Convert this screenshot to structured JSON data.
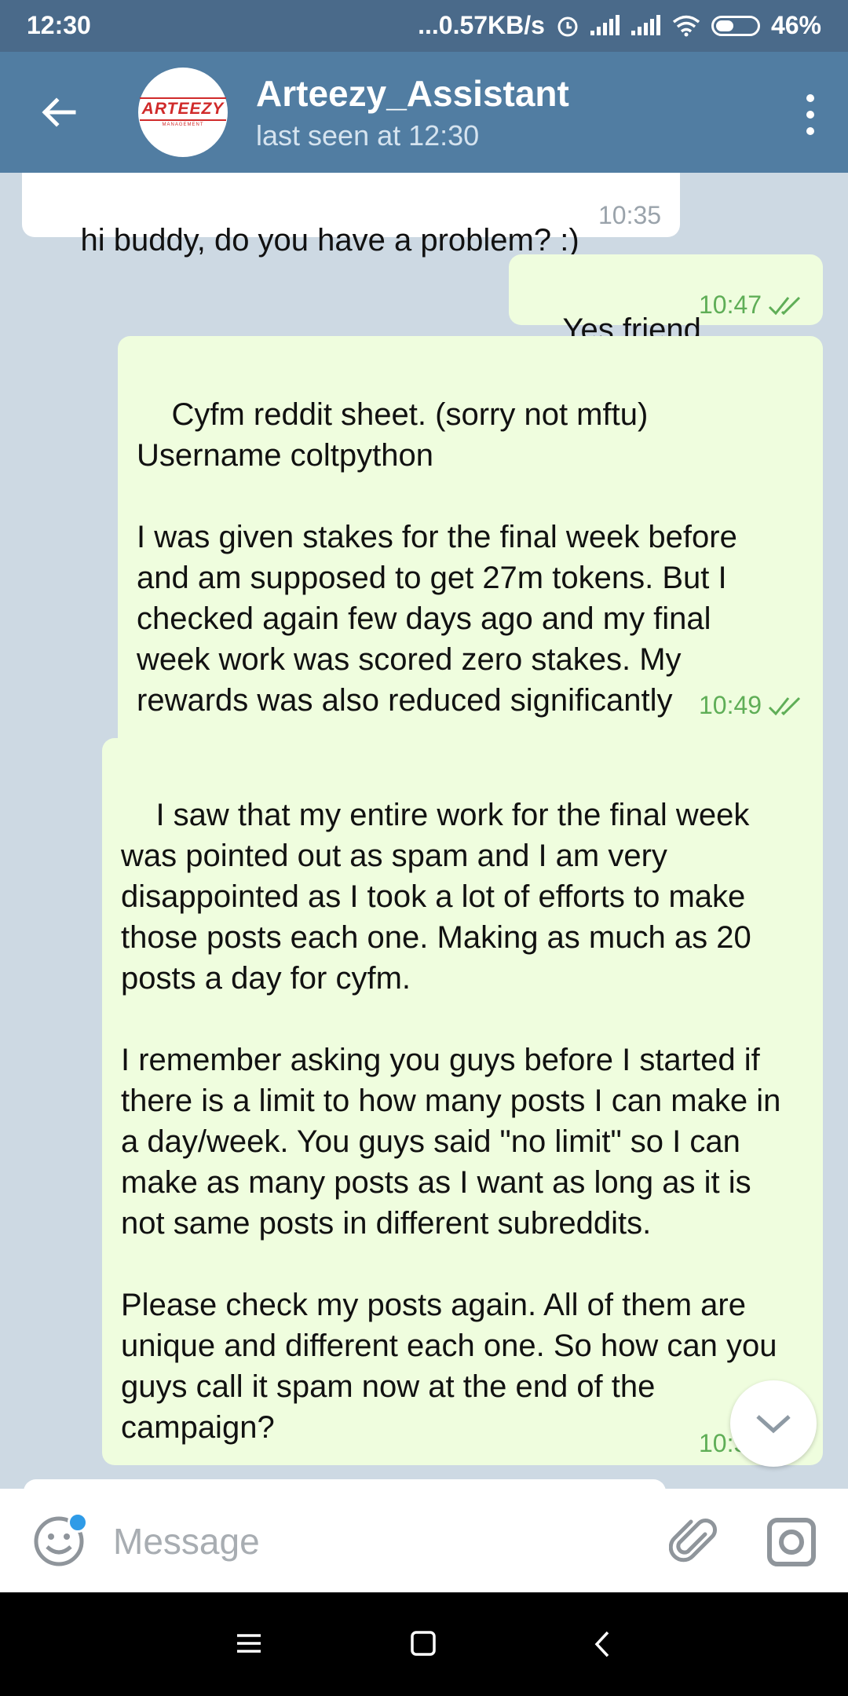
{
  "status_bar": {
    "time": "12:30",
    "net_speed": "...0.57KB/s",
    "battery": "46%"
  },
  "header": {
    "title": "Arteezy_Assistant",
    "subtitle": "last seen at 12:30",
    "avatar_text": "ARTEEZY",
    "avatar_subtext": "MANAGEMENT"
  },
  "messages": [
    {
      "direction": "incoming",
      "text": "hi buddy, do you have a problem? :)",
      "time": "10:35"
    },
    {
      "direction": "outgoing",
      "text": "Yes friend",
      "time": "10:47",
      "status": "read"
    },
    {
      "direction": "outgoing",
      "text": "Cyfm reddit sheet. (sorry not mftu)\nUsername coltpython\n\nI was given stakes for the final week before and am supposed to get 27m tokens. But I checked again few days ago and my final week work was scored zero stakes. My rewards was also reduced significantly",
      "time": "10:49",
      "status": "read"
    },
    {
      "direction": "outgoing",
      "text": "I saw that my entire work for the final week was pointed out as spam and I am very disappointed as I took a lot of efforts to make those posts each one. Making as much as 20 posts a day for cyfm.\n\nI remember asking you guys before I started if there is a limit to how many posts I can make in a day/week. You guys said \"no limit\" so I can make as many posts as I want as long as it is not same posts in different subreddits.\n\nPlease check my posts again. All of them are unique and different each one. So how can you guys call it spam now at the end of the campaign?",
      "time": "10:5"
    }
  ],
  "input": {
    "placeholder": "Message"
  },
  "colors": {
    "header_bg": "#517da2",
    "status_bg": "#4a6a8a",
    "outgoing_bubble": "#effdde",
    "incoming_bubble": "#ffffff",
    "check_color": "#5fae57",
    "chat_bg": "#cdd9e3"
  },
  "icons": {
    "back": "arrow-left",
    "menu": "three-dots-vertical",
    "emoji": "smile",
    "attach": "paperclip",
    "camera": "instagram-camera",
    "scroll": "chevron-down"
  }
}
